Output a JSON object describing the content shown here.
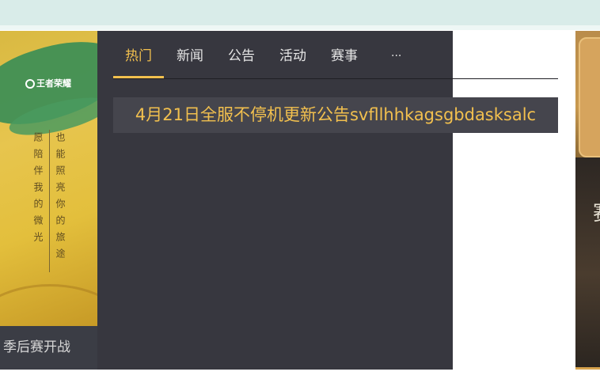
{
  "banner": {
    "logo_text": "王者荣耀",
    "vertical_text_1": "愿陪伴我的微光",
    "vertical_text_2": "也能照亮你的旅途",
    "caption": "季后赛开战"
  },
  "tabs": [
    {
      "label": "热门",
      "active": true
    },
    {
      "label": "新闻",
      "active": false
    },
    {
      "label": "公告",
      "active": false
    },
    {
      "label": "活动",
      "active": false
    },
    {
      "label": "赛事",
      "active": false
    },
    {
      "label": "...",
      "active": false
    }
  ],
  "headline": "4月21日全服不停机更新公告svfllhhkagsgbdasksalc",
  "right_strip": {
    "glyph": "赛"
  },
  "colors": {
    "accent": "#f2c04e",
    "panel_bg": "#37373f",
    "headline_bg": "#45454d",
    "topbar": "#d9ece9"
  }
}
